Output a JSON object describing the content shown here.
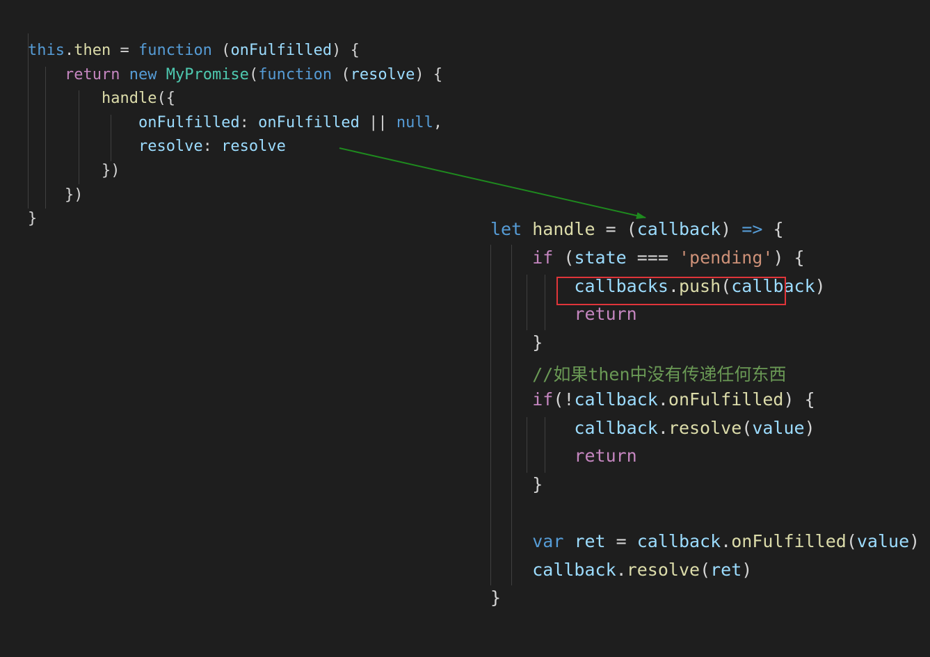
{
  "left_block": {
    "lines": [
      [
        {
          "t": "this",
          "c": "kw"
        },
        {
          "t": ".",
          "c": "punc"
        },
        {
          "t": "then",
          "c": "fn"
        },
        {
          "t": " = ",
          "c": "punc"
        },
        {
          "t": "function",
          "c": "kw"
        },
        {
          "t": " (",
          "c": "punc"
        },
        {
          "t": "onFulfilled",
          "c": "var"
        },
        {
          "t": ") {",
          "c": "punc"
        }
      ],
      [
        {
          "t": "    ",
          "c": "punc"
        },
        {
          "t": "return",
          "c": "ctrl"
        },
        {
          "t": " ",
          "c": "punc"
        },
        {
          "t": "new",
          "c": "kw"
        },
        {
          "t": " ",
          "c": "punc"
        },
        {
          "t": "MyPromise",
          "c": "cls"
        },
        {
          "t": "(",
          "c": "punc"
        },
        {
          "t": "function",
          "c": "kw"
        },
        {
          "t": " (",
          "c": "punc"
        },
        {
          "t": "resolve",
          "c": "var"
        },
        {
          "t": ") {",
          "c": "punc"
        }
      ],
      [
        {
          "t": "        ",
          "c": "punc"
        },
        {
          "t": "handle",
          "c": "fn"
        },
        {
          "t": "({",
          "c": "punc"
        }
      ],
      [
        {
          "t": "            ",
          "c": "punc"
        },
        {
          "t": "onFulfilled",
          "c": "var"
        },
        {
          "t": ": ",
          "c": "punc"
        },
        {
          "t": "onFulfilled",
          "c": "var"
        },
        {
          "t": " || ",
          "c": "punc"
        },
        {
          "t": "null",
          "c": "kw"
        },
        {
          "t": ",",
          "c": "punc"
        }
      ],
      [
        {
          "t": "            ",
          "c": "punc"
        },
        {
          "t": "resolve",
          "c": "var"
        },
        {
          "t": ": ",
          "c": "punc"
        },
        {
          "t": "resolve",
          "c": "var"
        }
      ],
      [
        {
          "t": "        ",
          "c": "punc"
        },
        {
          "t": "})",
          "c": "punc"
        }
      ],
      [
        {
          "t": "    ",
          "c": "punc"
        },
        {
          "t": "})",
          "c": "punc"
        }
      ],
      [
        {
          "t": "}",
          "c": "punc"
        }
      ]
    ]
  },
  "right_block": {
    "lines": [
      [
        {
          "t": "let",
          "c": "kw"
        },
        {
          "t": " ",
          "c": "punc"
        },
        {
          "t": "handle",
          "c": "fn"
        },
        {
          "t": " = (",
          "c": "punc"
        },
        {
          "t": "callback",
          "c": "var"
        },
        {
          "t": ") ",
          "c": "punc"
        },
        {
          "t": "=>",
          "c": "kw"
        },
        {
          "t": " {",
          "c": "punc"
        }
      ],
      [
        {
          "t": "    ",
          "c": "punc"
        },
        {
          "t": "if",
          "c": "ctrl"
        },
        {
          "t": " (",
          "c": "punc"
        },
        {
          "t": "state",
          "c": "var"
        },
        {
          "t": " === ",
          "c": "punc"
        },
        {
          "t": "'pending'",
          "c": "str"
        },
        {
          "t": ") {",
          "c": "punc"
        }
      ],
      [
        {
          "t": "        ",
          "c": "punc"
        },
        {
          "t": "callbacks",
          "c": "var"
        },
        {
          "t": ".",
          "c": "punc"
        },
        {
          "t": "push",
          "c": "fn"
        },
        {
          "t": "(",
          "c": "punc"
        },
        {
          "t": "callback",
          "c": "var"
        },
        {
          "t": ")",
          "c": "punc"
        }
      ],
      [
        {
          "t": "        ",
          "c": "punc"
        },
        {
          "t": "return",
          "c": "ctrl"
        }
      ],
      [
        {
          "t": "    ",
          "c": "punc"
        },
        {
          "t": "}",
          "c": "punc"
        }
      ],
      [
        {
          "t": "    ",
          "c": "punc"
        },
        {
          "t": "//如果then中没有传递任何东西",
          "c": "cmt"
        }
      ],
      [
        {
          "t": "    ",
          "c": "punc"
        },
        {
          "t": "if",
          "c": "ctrl"
        },
        {
          "t": "(!",
          "c": "punc"
        },
        {
          "t": "callback",
          "c": "var"
        },
        {
          "t": ".",
          "c": "punc"
        },
        {
          "t": "onFulfilled",
          "c": "fn"
        },
        {
          "t": ") {",
          "c": "punc"
        }
      ],
      [
        {
          "t": "        ",
          "c": "punc"
        },
        {
          "t": "callback",
          "c": "var"
        },
        {
          "t": ".",
          "c": "punc"
        },
        {
          "t": "resolve",
          "c": "fn"
        },
        {
          "t": "(",
          "c": "punc"
        },
        {
          "t": "value",
          "c": "var"
        },
        {
          "t": ")",
          "c": "punc"
        }
      ],
      [
        {
          "t": "        ",
          "c": "punc"
        },
        {
          "t": "return",
          "c": "ctrl"
        }
      ],
      [
        {
          "t": "    ",
          "c": "punc"
        },
        {
          "t": "}",
          "c": "punc"
        }
      ],
      [],
      [
        {
          "t": "    ",
          "c": "punc"
        },
        {
          "t": "var",
          "c": "kw"
        },
        {
          "t": " ",
          "c": "punc"
        },
        {
          "t": "ret",
          "c": "var"
        },
        {
          "t": " = ",
          "c": "punc"
        },
        {
          "t": "callback",
          "c": "var"
        },
        {
          "t": ".",
          "c": "punc"
        },
        {
          "t": "onFulfilled",
          "c": "fn"
        },
        {
          "t": "(",
          "c": "punc"
        },
        {
          "t": "value",
          "c": "var"
        },
        {
          "t": ")",
          "c": "punc"
        }
      ],
      [
        {
          "t": "    ",
          "c": "punc"
        },
        {
          "t": "callback",
          "c": "var"
        },
        {
          "t": ".",
          "c": "punc"
        },
        {
          "t": "resolve",
          "c": "fn"
        },
        {
          "t": "(",
          "c": "punc"
        },
        {
          "t": "ret",
          "c": "var"
        },
        {
          "t": ")",
          "c": "punc"
        }
      ],
      [
        {
          "t": "}",
          "c": "punc"
        }
      ]
    ]
  },
  "annotations": {
    "arrow_color": "#1e8a1e",
    "highlight_color": "#e0353a",
    "highlight_target": "callbacks.push(callback)"
  },
  "theme": {
    "background": "#1e1e1e"
  }
}
